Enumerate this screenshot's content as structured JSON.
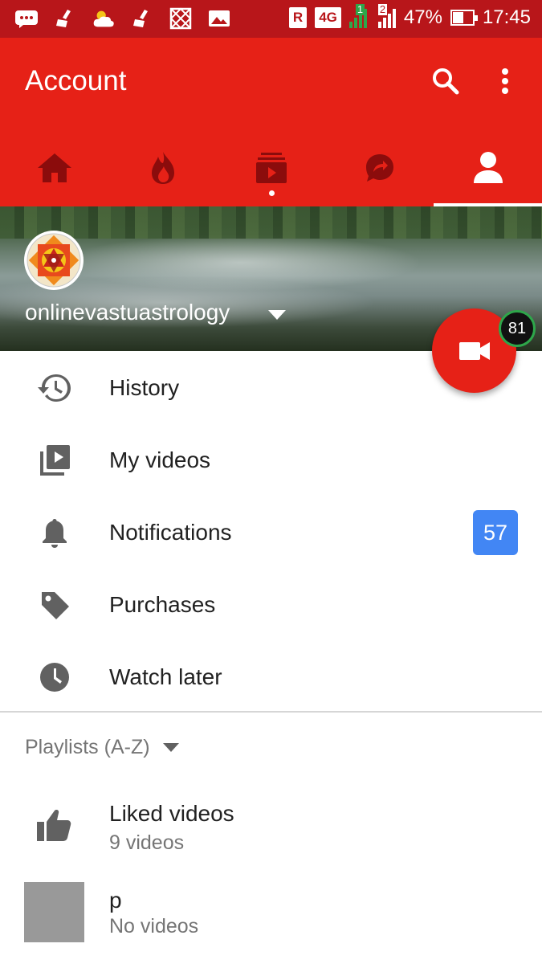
{
  "status_bar": {
    "sim_r": "R",
    "network": "4G",
    "sim1": "1",
    "sim2": "2",
    "battery": "47%",
    "time": "17:45"
  },
  "appbar": {
    "title": "Account"
  },
  "tabs": [
    {
      "icon": "home-icon"
    },
    {
      "icon": "trending-icon"
    },
    {
      "icon": "subscriptions-icon",
      "dot": true
    },
    {
      "icon": "shared-icon"
    },
    {
      "icon": "account-icon",
      "selected": true
    }
  ],
  "channel": {
    "name": "onlinevastuastrology"
  },
  "upload": {
    "counter": "81"
  },
  "menu": [
    {
      "label": "History",
      "icon": "history-icon"
    },
    {
      "label": "My videos",
      "icon": "my-videos-icon"
    },
    {
      "label": "Notifications",
      "icon": "bell-icon",
      "badge": "57"
    },
    {
      "label": "Purchases",
      "icon": "tag-icon"
    },
    {
      "label": "Watch later",
      "icon": "clock-icon"
    }
  ],
  "playlists": {
    "header": "Playlists (A-Z)",
    "items": [
      {
        "title": "Liked videos",
        "sub": "9 videos"
      },
      {
        "title": "p",
        "sub": "No videos"
      }
    ]
  },
  "colors": {
    "status_bar": "#b8161a",
    "app_bar": "#e62117",
    "badge": "#4286f4",
    "counter_ring": "#2ea64a"
  }
}
